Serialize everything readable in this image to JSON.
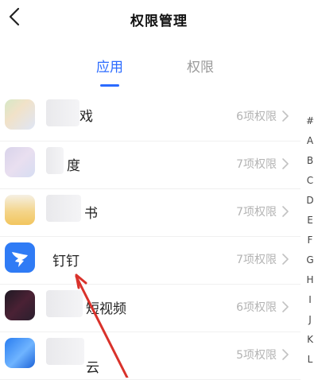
{
  "header": {
    "title": "权限管理"
  },
  "tabs": [
    {
      "label": "应用",
      "active": true
    },
    {
      "label": "权限",
      "active": false
    }
  ],
  "apps": [
    {
      "name": "戏",
      "permissions": "6项权限",
      "icon": "blurred-app-icon"
    },
    {
      "name": "度",
      "permissions": "7项权限",
      "icon": "blurred-app-icon"
    },
    {
      "name": "书",
      "permissions": "7项权限",
      "icon": "blurred-app-icon"
    },
    {
      "name": "钉钉",
      "permissions": "7项权限",
      "icon": "dingtalk-icon"
    },
    {
      "name": "短视频",
      "permissions": "6项权限",
      "icon": "blurred-app-icon"
    },
    {
      "name": "云",
      "permissions": "5项权限",
      "icon": "blurred-app-icon"
    }
  ],
  "index_letters": [
    "#",
    "A",
    "B",
    "C",
    "D",
    "E",
    "F",
    "G",
    "H",
    "I",
    "J",
    "K",
    "L"
  ],
  "colors": {
    "accent": "#2b6bff",
    "annotation_arrow": "#d9322b",
    "dingtalk": "#2f7bf5"
  }
}
